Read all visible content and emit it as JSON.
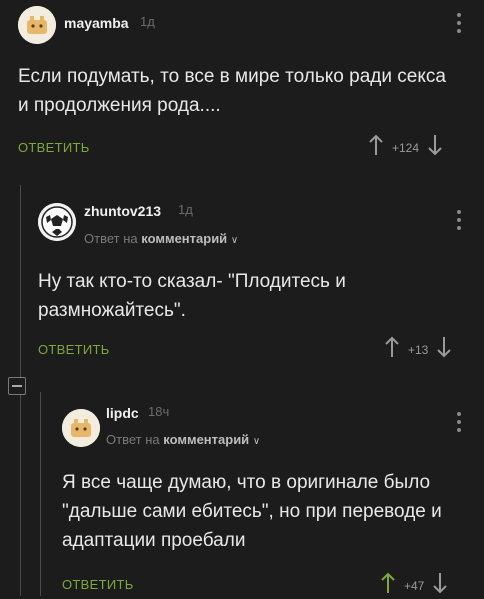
{
  "comments": [
    {
      "username": "mayamba",
      "time": "1д",
      "text": "Если подумать, то все в мире только ради секса и продолжения рода....",
      "reply_label": "ОТВЕТИТЬ",
      "score": "+124"
    },
    {
      "username": "zhuntov213",
      "time": "1д",
      "reply_prefix": "Ответ на",
      "reply_target": "комментарий",
      "text": "Ну так кто-то сказал- \"Плодитесь и размножайтесь\".",
      "reply_label": "ОТВЕТИТЬ",
      "score": "+13"
    },
    {
      "username": "lipdc",
      "time": "18ч",
      "reply_prefix": "Ответ на",
      "reply_target": "комментарий",
      "text": "Я все чаще думаю, что в оригинале было \"дальше сами ебитесь\", но при переводе и адаптации проебали",
      "reply_label": "ОТВЕТИТЬ",
      "score": "+47"
    }
  ],
  "colors": {
    "background": "#1c1c1c",
    "accent_reply": "#7fa83a"
  }
}
